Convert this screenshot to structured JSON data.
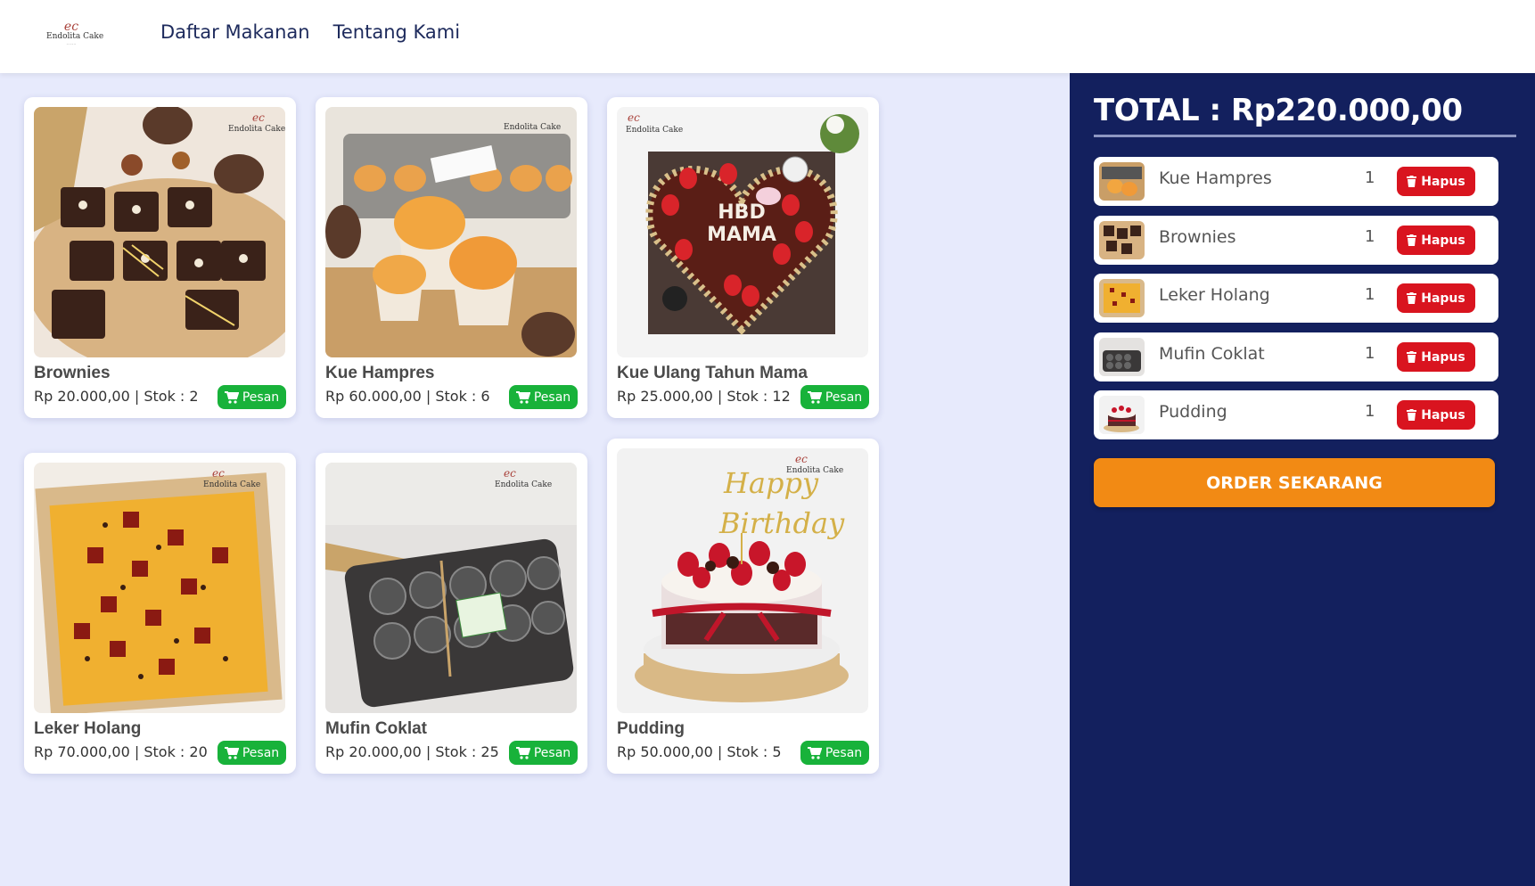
{
  "brand": {
    "logo_mark": "ec",
    "logo_name": "Endolita Cake"
  },
  "nav": {
    "items": [
      "Daftar Makanan",
      "Tentang Kami"
    ]
  },
  "products": [
    {
      "name": "Brownies",
      "info": "Rp 20.000,00 | Stok : 2",
      "button": "Pesan"
    },
    {
      "name": "Kue Hampres",
      "info": "Rp 60.000,00 | Stok : 6",
      "button": "Pesan"
    },
    {
      "name": "Kue Ulang Tahun Mama",
      "info": "Rp 25.000,00 | Stok : 12",
      "button": "Pesan"
    },
    {
      "name": "Leker Holang",
      "info": "Rp 70.000,00 | Stok : 20",
      "button": "Pesan"
    },
    {
      "name": "Mufin Coklat",
      "info": "Rp 20.000,00 | Stok : 25",
      "button": "Pesan"
    },
    {
      "name": "Pudding",
      "info": "Rp 50.000,00 | Stok : 5",
      "button": "Pesan"
    }
  ],
  "cart": {
    "total": "TOTAL : Rp220.000,00",
    "items": [
      {
        "name": "Kue Hampres",
        "qty": "1",
        "button": "Hapus"
      },
      {
        "name": "Brownies",
        "qty": "1",
        "button": "Hapus"
      },
      {
        "name": "Leker Holang",
        "qty": "1",
        "button": "Hapus"
      },
      {
        "name": "Mufin Coklat",
        "qty": "1",
        "button": "Hapus"
      },
      {
        "name": "Pudding",
        "qty": "1",
        "button": "Hapus"
      }
    ],
    "order_label": "ORDER SEKARANG"
  },
  "colors": {
    "page_bg": "#e7eafc",
    "cart_bg": "#13205e",
    "pesan_green": "#18b23a",
    "hapus_red": "#d9141f",
    "order_orange": "#f28a14",
    "nav_text": "#1d2a5c"
  },
  "icons": {
    "cart": "cart-icon",
    "trash": "trash-icon"
  }
}
